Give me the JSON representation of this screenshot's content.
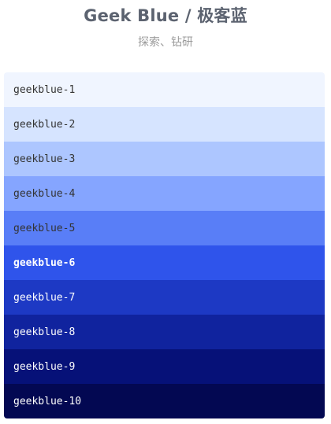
{
  "header": {
    "title": "Geek Blue / 极客蓝",
    "subtitle": "探索、钻研"
  },
  "swatches": [
    {
      "name": "geekblue-1",
      "color": "#f0f5ff",
      "text_color": "#333333",
      "bold": false
    },
    {
      "name": "geekblue-2",
      "color": "#d6e4ff",
      "text_color": "#333333",
      "bold": false
    },
    {
      "name": "geekblue-3",
      "color": "#adc6ff",
      "text_color": "#333333",
      "bold": false
    },
    {
      "name": "geekblue-4",
      "color": "#85a5ff",
      "text_color": "#333333",
      "bold": false
    },
    {
      "name": "geekblue-5",
      "color": "#597ef7",
      "text_color": "#333333",
      "bold": false
    },
    {
      "name": "geekblue-6",
      "color": "#2f54eb",
      "text_color": "#ffffff",
      "bold": true
    },
    {
      "name": "geekblue-7",
      "color": "#1d39c4",
      "text_color": "#ffffff",
      "bold": false
    },
    {
      "name": "geekblue-8",
      "color": "#10239e",
      "text_color": "#ffffff",
      "bold": false
    },
    {
      "name": "geekblue-9",
      "color": "#061178",
      "text_color": "#ffffff",
      "bold": false
    },
    {
      "name": "geekblue-10",
      "color": "#030852",
      "text_color": "#ffffff",
      "bold": false
    }
  ]
}
